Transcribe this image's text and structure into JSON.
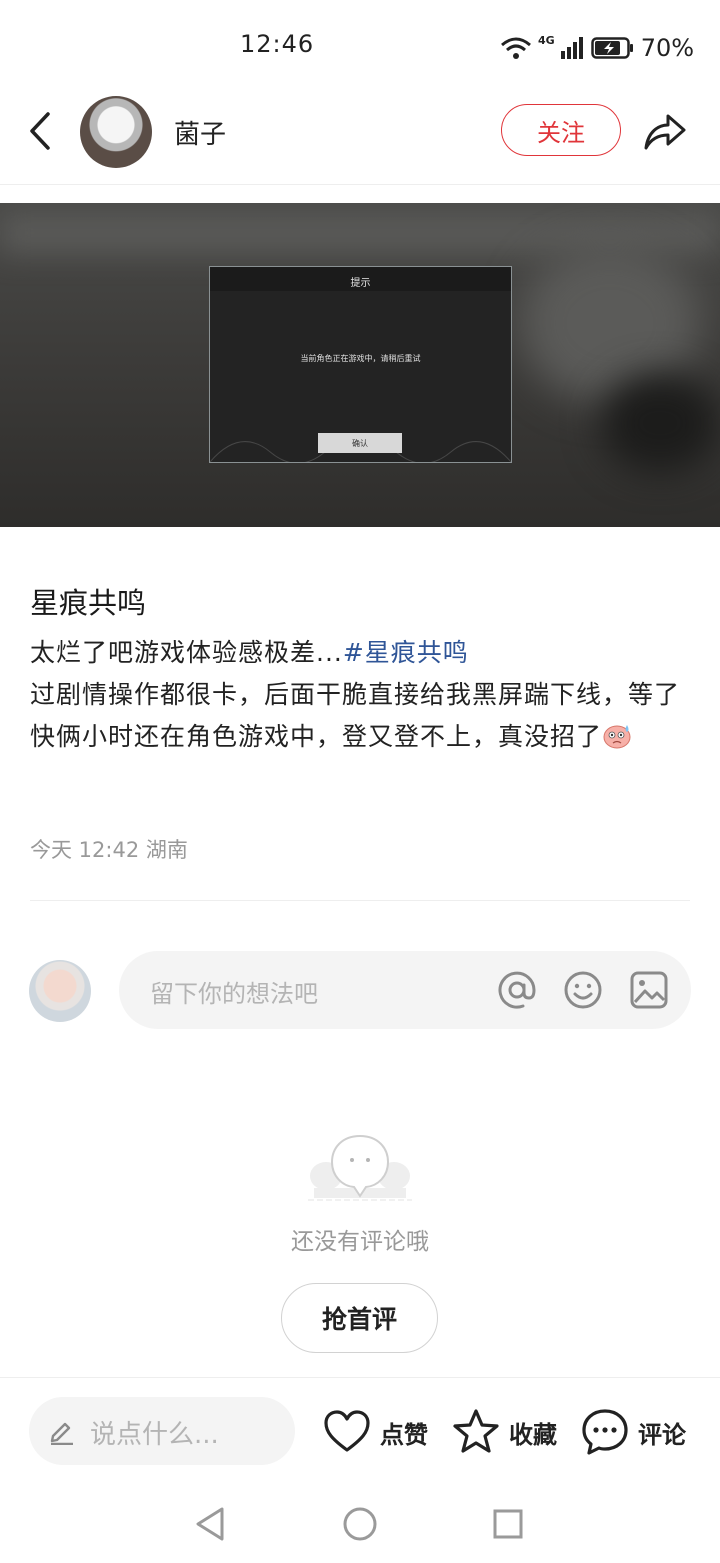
{
  "status_bar": {
    "time": "12:46",
    "network": "4G",
    "battery": "70%"
  },
  "header": {
    "back_icon": "chevron-left-icon",
    "username": "菌子",
    "follow_label": "关注",
    "share_icon": "share-arrow-icon",
    "accent_color": "#e0353a"
  },
  "post_image": {
    "dialog_title": "提示",
    "dialog_message": "当前角色正在游戏中，请稍后重试",
    "dialog_button": "确认"
  },
  "post": {
    "title": "星痕共鸣",
    "body_line1": "太烂了吧游戏体验感极差...",
    "tag": "#星痕共鸣",
    "body_rest": "过剧情操作都很卡，后面干脆直接给我黑屏踹下线，等了快俩小时还在角色游戏中，登又登不上，真没招了",
    "meta": "今天 12:42 湖南"
  },
  "comment_box": {
    "placeholder": "留下你的想法吧",
    "icons": [
      "at-icon",
      "emoji-icon",
      "image-icon"
    ]
  },
  "empty_state": {
    "text": "还没有评论哦",
    "button": "抢首评"
  },
  "bottom_bar": {
    "say_placeholder": "说点什么...",
    "like_label": "点赞",
    "favorite_label": "收藏",
    "comment_label": "评论"
  }
}
